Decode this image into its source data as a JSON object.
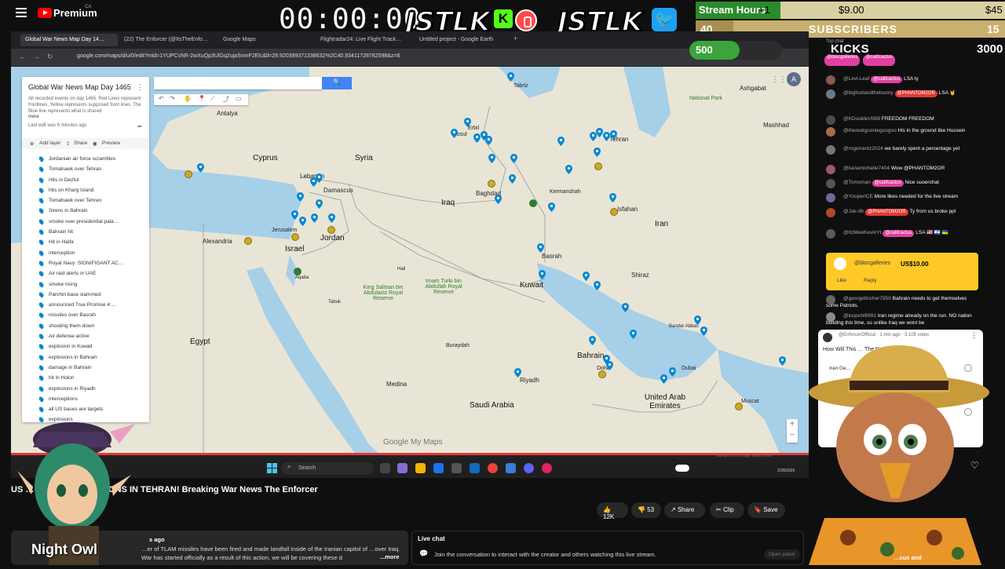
{
  "youtube": {
    "brand": "Premium",
    "region": "CA"
  },
  "overlay": {
    "timer": "00:00:00",
    "jstlk_left": "JSTLK",
    "kick_letter": "K",
    "jstlk_right": "JSTLK",
    "stream_hours_label": "Stream Hours",
    "stream_hours_plus": "+1",
    "money_1": "$9.00",
    "money_2": "$45",
    "subs_count": "40",
    "subs_label": "SUBSCRIBERS",
    "subs_goal": "15",
    "xp_value": "500",
    "xp_progress": 0.54,
    "kicks_label": "KICKS",
    "kicks_value": "3000",
    "night_owl": "Night Owl",
    "accent_green": "#3ca43c",
    "accent_gold": "#d8d0a0"
  },
  "browser": {
    "tabs": [
      {
        "label": "Global War News Map Day 14…",
        "active": true
      },
      {
        "label": "(22) The Enforcer (@ItsTheEnfo…",
        "active": false
      },
      {
        "label": "Google Maps",
        "active": false
      },
      {
        "label": "Flightradar24: Live Flight Track…",
        "active": false
      },
      {
        "label": "Untitled project - Google Earth",
        "active": false
      }
    ],
    "url": "google.com/maps/d/u/0/edit?mid=1YUPCVkR-2wXuQp3UlGq2ujaSnmF2Elc&ll=29.92039937133863​2%2C40.9341172878259​8&z=6"
  },
  "mymaps": {
    "title": "Global War News Map Day 1465",
    "description": "All recorded events on day 1465. Red Lines represent frontlines, Yellow represents supposed front lines. The Blue line represents what is shared",
    "more": "more",
    "last_edit": "Last edit was 6 minutes ago",
    "add_layer": "Add layer",
    "share": "Share",
    "preview": "Preview",
    "layers": [
      "Jordanian air force scrambles",
      "Tomahawk over Tehran",
      "Hits in Dezful",
      "hits on Kharg Island",
      "Tomahawk over Tehran",
      "Sirens in Bahrain",
      "smoke over presidential pala…",
      "Bahrain hit",
      "Hit in Haifa",
      "interception",
      "Royal Navy: SIGNIFIGANT AC…",
      "Air raid alerts in UAE",
      "smoke rising",
      "Parchin base slammed",
      "announced True Promise 4:…",
      "missiles over Basrah",
      "shooting them down",
      "Air defense active",
      "explosion in Kuwait",
      "explosions in Bahrain",
      "damage in Bahrain",
      "hit in Holon",
      "explosions in Riyadh",
      "interceptions",
      "all US bases are targets",
      "explosions"
    ],
    "footer": "Google My Maps",
    "attribution": "Map data ©2026 Google, Mapa GISrael"
  },
  "map_labels": {
    "cyprus": "Cyprus",
    "syria": "Syria",
    "lebanon": "Lebanon",
    "damascus": "Damascus",
    "iraq": "Iraq",
    "iran": "Iran",
    "jordan": "Jordan",
    "israel": "Israel",
    "egypt": "Egypt",
    "kuwait": "Kuwait",
    "saudi_arabia": "Saudi Arabia",
    "bahrain": "Bahrain",
    "uae": "United Arab Emirates",
    "riyadh": "Riyadh",
    "baghdad": "Baghdad",
    "tehran": "Tehran",
    "isfahan": "Isfahan",
    "mashhad": "Mashhad",
    "ashgabat": "Ashgabat",
    "alexandria": "Alexandria",
    "antalya": "Antalya",
    "jerusalem": "Jerusalem",
    "basrah": "Basrah",
    "shiraz": "Shiraz",
    "medina": "Medina",
    "dubai": "Dubai",
    "muscat": "Muscat",
    "doha": "Doha",
    "bandar_abbas": "Bandar Abbas",
    "erbil": "Erbil",
    "mosul": "Mosul",
    "tabriz": "Tabriz",
    "kermanshah": "Kermanshah",
    "buraydah": "Buraydah",
    "king_salman": "King Salman bin Abdulaziz Royal Reserve",
    "imam_turki": "Imam Turki bin Abdullah Royal Reserve",
    "national_park": "National Park",
    "tabuk": "Tabuk",
    "hail": "Hail",
    "aqaba": "Aqaba"
  },
  "taskbar": {
    "search": "Search",
    "date": "2/28/2026"
  },
  "video": {
    "title": "US … H IRAN, EXPLOSIONS IN TEHRAN! Breaking War News The Enforcer",
    "likes": "12K",
    "dislikes": "53",
    "share": "Share",
    "clip": "Clip",
    "save": "Save",
    "ago": "s ago",
    "description": "…er of TLAM missiles have been fired and made landfall inside of the Iranian capitol of …over Iraq. War has started officially as a result of this action, we will be covering these d",
    "more": "...more"
  },
  "live_chat": {
    "title": "Live chat",
    "prompt": "Join the conversation to interact with the creator and others watching this live stream.",
    "open_panel": "Open panel"
  },
  "chat": {
    "top_chat": "Top chat",
    "messages": [
      {
        "user": "@Levi-Leaf",
        "badge": "@califcactus",
        "text": "LSA ty"
      },
      {
        "user": "@bigfootandthebunny",
        "badge": "@PHANTOM2OR",
        "text": "LSA 🤘"
      },
      {
        "user": "@KDoubleU999",
        "badge": "",
        "text": "FREEDOM FREEDOM"
      },
      {
        "user": "@therealgooniegoogoo",
        "badge": "",
        "text": "His in the ground like Hussein"
      },
      {
        "user": "@rogerrantz2024",
        "badge": "",
        "text": "we barely spent a percentage yet"
      },
      {
        "user": "@kanamichelle7404",
        "badge": "",
        "text": "Wow @PHANTOM2OR"
      },
      {
        "user": "@Tomxman",
        "badge": "@califcactus",
        "text": "Nice suoerchat"
      },
      {
        "user": "@YooperICE",
        "badge": "",
        "text": "More likes needed for the live stream"
      },
      {
        "user": "@Jsk-r8r",
        "badge": "@PHANTOM2OR",
        "text": "Ty from us broke ppl"
      },
      {
        "user": "@ItzMeeKevinYt",
        "badge": "@califcactus",
        "text": "LSA 🇺🇸 🇮🇱 🇺🇦"
      },
      {
        "user": "@georgetincher7859",
        "badge": "",
        "text": "Bahrain needs to get themselves some Patriots."
      },
      {
        "user": "@loupohl6991",
        "badge": "",
        "text": "Iran regime already on the run. NO nation building this time, so unlike Iraq we wont be"
      }
    ],
    "superchat": {
      "user": "@blocgalleries",
      "amount": "US$10.00",
      "like": "Like",
      "reply": "Reply"
    },
    "poll": {
      "author": "@EnforcerOfficial · 1 min ago · 3,105 votes",
      "question": "How Will This … The Next Few Days?",
      "option": "Iran Ge…"
    },
    "footer_right": "…cus and"
  }
}
